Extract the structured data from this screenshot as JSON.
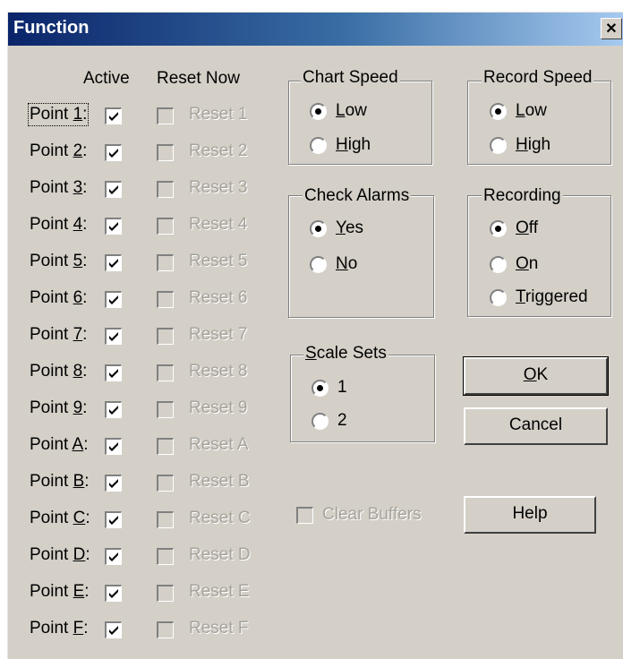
{
  "window": {
    "title": "Function",
    "close_glyph": "✕"
  },
  "columns": {
    "active": "Active",
    "reset_now": "Reset Now"
  },
  "points": [
    {
      "label_prefix": "Point ",
      "key": "1",
      "label_suffix": ":",
      "active": true,
      "reset": "Reset 1"
    },
    {
      "label_prefix": "Point ",
      "key": "2",
      "label_suffix": ":",
      "active": true,
      "reset": "Reset 2"
    },
    {
      "label_prefix": "Point ",
      "key": "3",
      "label_suffix": ":",
      "active": true,
      "reset": "Reset 3"
    },
    {
      "label_prefix": "Point ",
      "key": "4",
      "label_suffix": ":",
      "active": true,
      "reset": "Reset 4"
    },
    {
      "label_prefix": "Point ",
      "key": "5",
      "label_suffix": ":",
      "active": true,
      "reset": "Reset 5"
    },
    {
      "label_prefix": "Point ",
      "key": "6",
      "label_suffix": ":",
      "active": true,
      "reset": "Reset 6"
    },
    {
      "label_prefix": "Point ",
      "key": "7",
      "label_suffix": ":",
      "active": true,
      "reset": "Reset 7"
    },
    {
      "label_prefix": "Point ",
      "key": "8",
      "label_suffix": ":",
      "active": true,
      "reset": "Reset 8"
    },
    {
      "label_prefix": "Point ",
      "key": "9",
      "label_suffix": ":",
      "active": true,
      "reset": "Reset 9"
    },
    {
      "label_prefix": "Point ",
      "key": "A",
      "label_suffix": ":",
      "active": true,
      "reset": "Reset A"
    },
    {
      "label_prefix": "Point ",
      "key": "B",
      "label_suffix": ":",
      "active": true,
      "reset": "Reset B"
    },
    {
      "label_prefix": "Point ",
      "key": "C",
      "label_suffix": ":",
      "active": true,
      "reset": "Reset C"
    },
    {
      "label_prefix": "Point ",
      "key": "D",
      "label_suffix": ":",
      "active": true,
      "reset": "Reset D"
    },
    {
      "label_prefix": "Point ",
      "key": "E",
      "label_suffix": ":",
      "active": true,
      "reset": "Reset E"
    },
    {
      "label_prefix": "Point ",
      "key": "F",
      "label_suffix": ":",
      "active": true,
      "reset": "Reset F"
    }
  ],
  "chart_speed": {
    "title": "Chart Speed",
    "low": "Low",
    "high": "High",
    "selected": "low"
  },
  "record_speed": {
    "title": "Record Speed",
    "low": "Low",
    "high": "High",
    "selected": "low"
  },
  "check_alarms": {
    "title": "Check Alarms",
    "yes": "Yes",
    "no": "No",
    "selected": "yes"
  },
  "recording": {
    "title": "Recording",
    "off": "Off",
    "on": "On",
    "triggered": "Triggered",
    "selected": "off"
  },
  "scale_sets": {
    "title": "Scale Sets",
    "opt1": "1",
    "opt2": "2",
    "selected": "1"
  },
  "buttons": {
    "ok": "OK",
    "cancel": "Cancel",
    "help": "Help"
  },
  "clear_buffers": {
    "label": "Clear Buffers",
    "checked": false
  },
  "colors": {
    "titlebar_start": "#0a246a",
    "titlebar_end": "#a6caf0",
    "face": "#d4d0c8"
  },
  "icons": {
    "checkmark": "checkmark-icon",
    "close": "close-icon"
  }
}
